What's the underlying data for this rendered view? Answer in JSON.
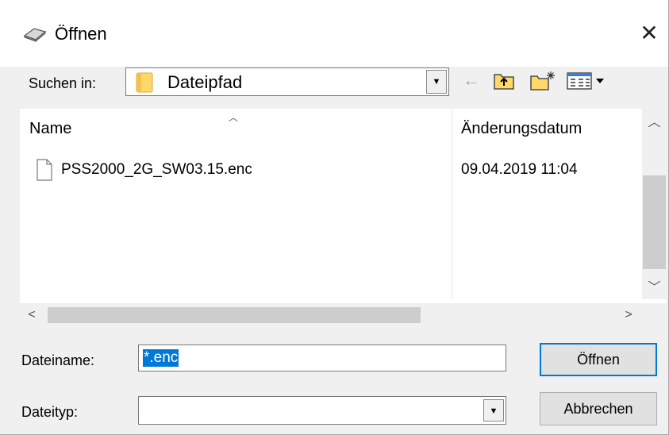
{
  "dialog": {
    "title": "Öffnen",
    "close_symbol": "✕"
  },
  "look_in": {
    "label": "Suchen in:",
    "value": "Dateipfad"
  },
  "toolbar": {
    "icons": [
      "back-arrow-icon",
      "up-folder-icon",
      "new-folder-icon",
      "view-menu-icon"
    ]
  },
  "file_list": {
    "columns": [
      "Name",
      "Änderungsdatum"
    ],
    "rows": [
      {
        "name": "PSS2000_2G_SW03.15.enc",
        "date": "09.04.2019 11:04"
      }
    ]
  },
  "file_name": {
    "label": "Dateiname:",
    "value": "*.enc"
  },
  "file_type": {
    "label": "Dateityp:",
    "value": ""
  },
  "buttons": {
    "open": "Öffnen",
    "cancel": "Abbrechen"
  },
  "colors": {
    "selection": "#0078d7",
    "dialog_bg": "#f0f0f0"
  }
}
